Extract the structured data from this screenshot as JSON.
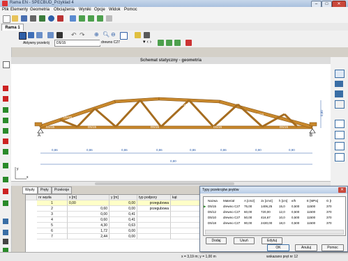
{
  "window": {
    "title": "Rama EN - SPECBUD_Przyklad 4",
    "min": "–",
    "max": "□",
    "close": "✕"
  },
  "menu": [
    "Plik",
    "Elementy",
    "Geometria",
    "Obciążenia",
    "Wyniki",
    "Opcje",
    "Widok",
    "Pomoc"
  ],
  "tab": {
    "label": "Rama 1"
  },
  "toolbar2": {
    "active_label": "Aktywny przekrój",
    "active_value": "D5/15",
    "material_value": "drewno C27"
  },
  "canvas": {
    "title": "Schemat statyczny - geometria"
  },
  "truss": {
    "member_label": "D5/15",
    "node_labels": [
      "A",
      "B"
    ],
    "dim_values": [
      "0,86",
      "0,86",
      "0,86",
      "0,86",
      "0,86",
      "0,86",
      "0,90",
      "0,90"
    ],
    "total_dim": "0,80",
    "height_dim": "0,80",
    "axis_y": "y",
    "axis_x": "x"
  },
  "bottom_tabs": [
    "Węzły",
    "Pręty",
    "Przekroje"
  ],
  "table": {
    "headers": [
      "nr węzła",
      "x [m]",
      "y [m]",
      "typ podpory",
      "kąt"
    ],
    "rows": [
      [
        "1",
        "0,00",
        "0,00",
        "przegubowa",
        ""
      ],
      [
        "2",
        "0,60",
        "0,00",
        "przegubowa",
        ""
      ],
      [
        "3",
        "0,00",
        "0,41",
        "",
        ""
      ],
      [
        "4",
        "0,60",
        "0,41",
        "",
        ""
      ],
      [
        "5",
        "4,30",
        "0,63",
        "",
        ""
      ],
      [
        "6",
        "1,72",
        "0,00",
        "",
        ""
      ],
      [
        "7",
        "2,44",
        "0,00",
        "",
        ""
      ]
    ]
  },
  "dialog": {
    "title": "Typy przekrojów prętów",
    "headers": [
      "Nazwa",
      "Materiał",
      "A [cm2]",
      "Jx [cm4]",
      "h [cm]",
      "e/h",
      "E [MPa]",
      "G [I"
    ],
    "rows": [
      [
        "D5/15",
        "drewno C27",
        "75,00",
        "1406,25",
        "15,0",
        "0,500",
        "11500",
        "370"
      ],
      [
        "D5/12",
        "drewno C27",
        "60,00",
        "720,00",
        "12,0",
        "0,500",
        "11500",
        "370"
      ],
      [
        "D5/10",
        "drewno C27",
        "50,00",
        "416,67",
        "10,0",
        "0,500",
        "11500",
        "370"
      ],
      [
        "D5/18",
        "drewno C27",
        "90,00",
        "2430,00",
        "18,0",
        "0,500",
        "11500",
        "370"
      ]
    ],
    "buttons": [
      "Dodaj",
      "Usuń",
      "Edytuj"
    ],
    "bottom_buttons": [
      "OK",
      "Anuluj",
      "Pomoc"
    ]
  },
  "status": {
    "coords": "x = 3,19 m; y = 1,00 m",
    "hint": "wskazano pręt nr 12"
  },
  "colors": {
    "member": "#c8882c",
    "member_edge": "#7a4a10",
    "dim": "#2a5aa8",
    "accent": "#3a6ea5"
  }
}
